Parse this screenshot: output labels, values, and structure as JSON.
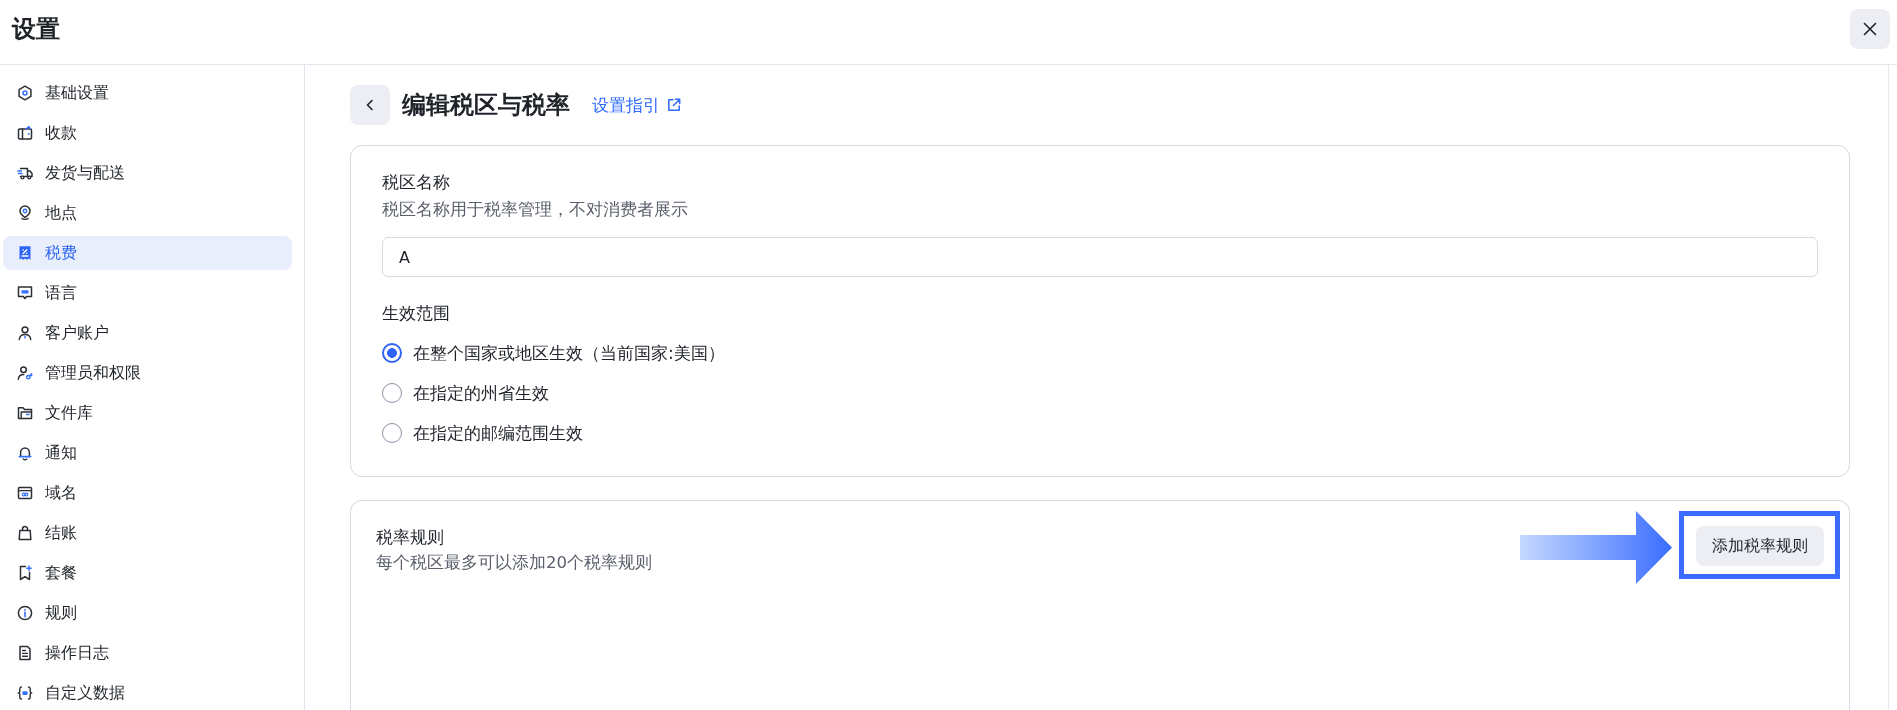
{
  "window": {
    "title": "设置"
  },
  "sidebar": {
    "items": [
      {
        "label": "基础设置",
        "selected": false
      },
      {
        "label": "收款",
        "selected": false
      },
      {
        "label": "发货与配送",
        "selected": false
      },
      {
        "label": "地点",
        "selected": false
      },
      {
        "label": "税费",
        "selected": true
      },
      {
        "label": "语言",
        "selected": false
      },
      {
        "label": "客户账户",
        "selected": false
      },
      {
        "label": "管理员和权限",
        "selected": false
      },
      {
        "label": "文件库",
        "selected": false
      },
      {
        "label": "通知",
        "selected": false
      },
      {
        "label": "域名",
        "selected": false
      },
      {
        "label": "结账",
        "selected": false
      },
      {
        "label": "套餐",
        "selected": false
      },
      {
        "label": "规则",
        "selected": false
      },
      {
        "label": "操作日志",
        "selected": false
      },
      {
        "label": "自定义数据",
        "selected": false
      }
    ]
  },
  "page": {
    "title": "编辑税区与税率",
    "guide_link": "设置指引"
  },
  "zone_card": {
    "name_label": "税区名称",
    "name_hint": "税区名称用于税率管理，不对消费者展示",
    "name_value": "A",
    "scope_label": "生效范围",
    "scope_options": [
      {
        "label": "在整个国家或地区生效（当前国家:美国）",
        "selected": true
      },
      {
        "label": "在指定的州省生效",
        "selected": false
      },
      {
        "label": "在指定的邮编范围生效",
        "selected": false
      }
    ]
  },
  "rates_card": {
    "title": "税率规则",
    "hint": "每个税区最多可以添加20个税率规则",
    "add_button": {
      "label": "添加税率规则",
      "highlighted": true
    }
  }
}
